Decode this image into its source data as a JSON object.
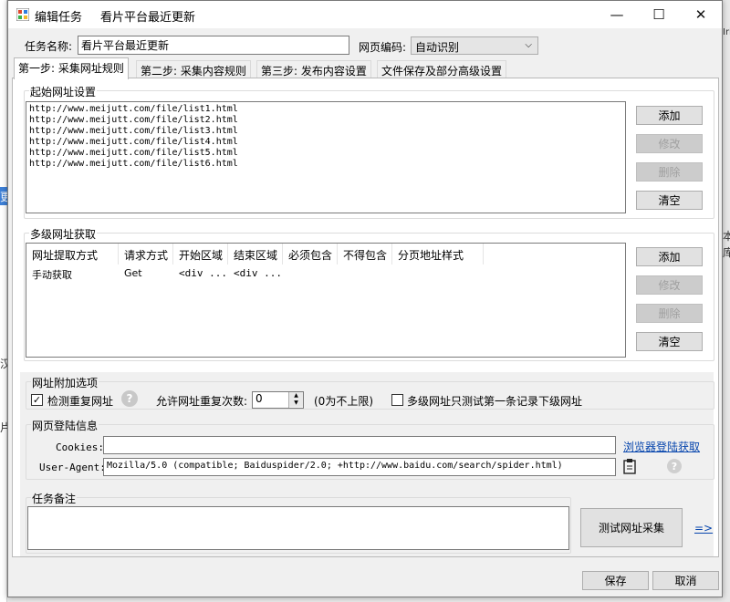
{
  "window": {
    "title": "编辑任务",
    "subtitle": "看片平台最近更新",
    "minimize": "—",
    "maximize": "☐",
    "close": "✕"
  },
  "task": {
    "name_label": "任务名称:",
    "name_value": "看片平台最近更新",
    "encoding_label": "网页编码:",
    "encoding_value": "自动识别"
  },
  "tabs": [
    {
      "label": "第一步: 采集网址规则",
      "active": true
    },
    {
      "label": "第二步: 采集内容规则",
      "active": false
    },
    {
      "label": "第三步: 发布内容设置",
      "active": false
    },
    {
      "label": "文件保存及部分高级设置",
      "active": false
    }
  ],
  "start_urls": {
    "title": "起始网址设置",
    "urls": [
      "http://www.meijutt.com/file/list1.html",
      "http://www.meijutt.com/file/list2.html",
      "http://www.meijutt.com/file/list3.html",
      "http://www.meijutt.com/file/list4.html",
      "http://www.meijutt.com/file/list5.html",
      "http://www.meijutt.com/file/list6.html"
    ],
    "buttons": {
      "add": "添加",
      "edit": "修改",
      "delete": "删除",
      "clear": "清空"
    }
  },
  "multi_level": {
    "title": "多级网址获取",
    "columns": [
      "网址提取方式",
      "请求方式",
      "开始区域",
      "结束区域",
      "必须包含",
      "不得包含",
      "分页地址样式"
    ],
    "rows": [
      [
        "手动获取",
        "Get",
        "<div ...",
        "<div ...",
        "",
        "",
        ""
      ]
    ],
    "buttons": {
      "add": "添加",
      "edit": "修改",
      "delete": "删除",
      "clear": "清空"
    }
  },
  "url_options": {
    "title": "网址附加选项",
    "check_duplicate_label": "检测重复网址",
    "check_duplicate_checked": true,
    "allow_repeat_label": "允许网址重复次数:",
    "allow_repeat_value": "0",
    "repeat_hint": "(0为不上限)",
    "first_record_label": "多级网址只测试第一条记录下级网址",
    "first_record_checked": false
  },
  "login": {
    "title": "网页登陆信息",
    "cookies_label": "Cookies:",
    "cookies_value": "",
    "browser_login_link": "浏览器登陆获取",
    "ua_label": "User-Agent:",
    "ua_value": "Mozilla/5.0 (compatible; Baiduspider/2.0; +http://www.baidu.com/search/spider.html)"
  },
  "notes": {
    "title": "任务备注",
    "value": ""
  },
  "test_button": "测试网址采集",
  "arrow_link": "=>",
  "footer": {
    "save": "保存",
    "cancel": "取消"
  },
  "help_glyph": "?",
  "check_glyph": "✓",
  "spin_up": "▲",
  "spin_down": "▼",
  "combo_arrow": "⌵",
  "background_marks": {
    "right_top": "Iri",
    "right_mid1": "本",
    "right_mid2": "库",
    "left_mid1": "更",
    "left_mid2": "汉",
    "left_mid3": "片"
  }
}
